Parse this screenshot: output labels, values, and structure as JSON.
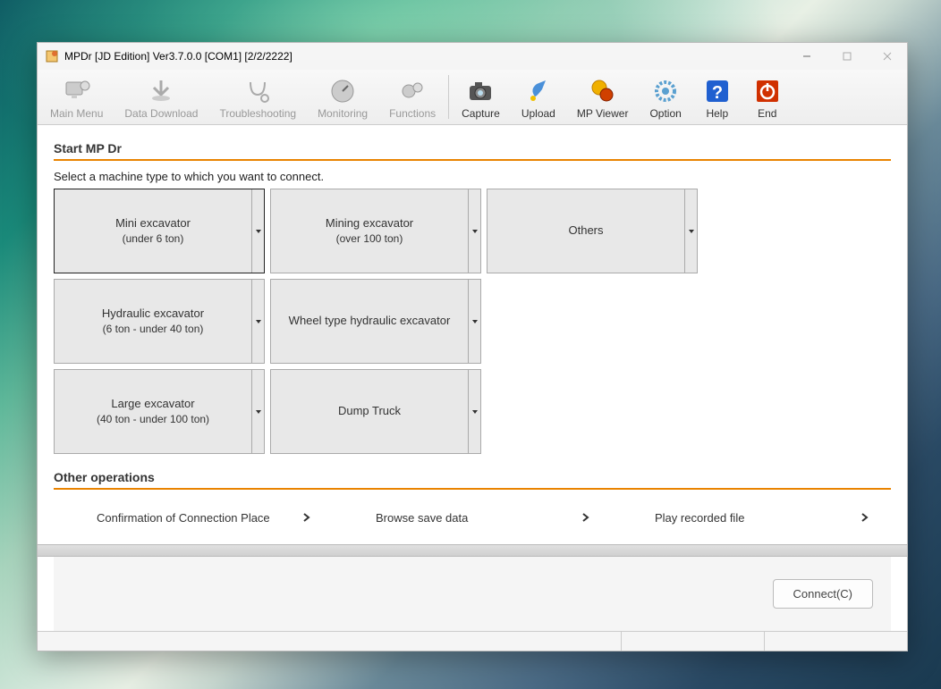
{
  "window": {
    "title": "MPDr [JD Edition] Ver3.7.0.0 [COM1] [2/2/2222]"
  },
  "toolbar": {
    "main_menu": "Main Menu",
    "data_download": "Data Download",
    "troubleshooting": "Troubleshooting",
    "monitoring": "Monitoring",
    "functions": "Functions",
    "capture": "Capture",
    "upload": "Upload",
    "mp_viewer": "MP Viewer",
    "option": "Option",
    "help": "Help",
    "end": "End"
  },
  "main": {
    "heading": "Start MP Dr",
    "prompt": "Select a machine type to which you want to connect.",
    "machines": [
      {
        "name": "Mini excavator",
        "sub": "(under 6 ton)",
        "selected": true
      },
      {
        "name": "Mining excavator",
        "sub": "(over 100 ton)",
        "selected": false
      },
      {
        "name": "Others",
        "sub": "",
        "selected": false
      },
      {
        "name": "Hydraulic excavator",
        "sub": "(6 ton - under 40 ton)",
        "selected": false
      },
      {
        "name": "Wheel type hydraulic excavator",
        "sub": "",
        "selected": false
      },
      {
        "name": "Large excavator",
        "sub": "(40 ton - under 100 ton)",
        "selected": false
      },
      {
        "name": "Dump Truck",
        "sub": "",
        "selected": false
      }
    ],
    "ops_heading": "Other operations",
    "ops": [
      "Confirmation of Connection Place",
      "Browse save data",
      "Play recorded file"
    ],
    "connect_label": "Connect(C)"
  }
}
